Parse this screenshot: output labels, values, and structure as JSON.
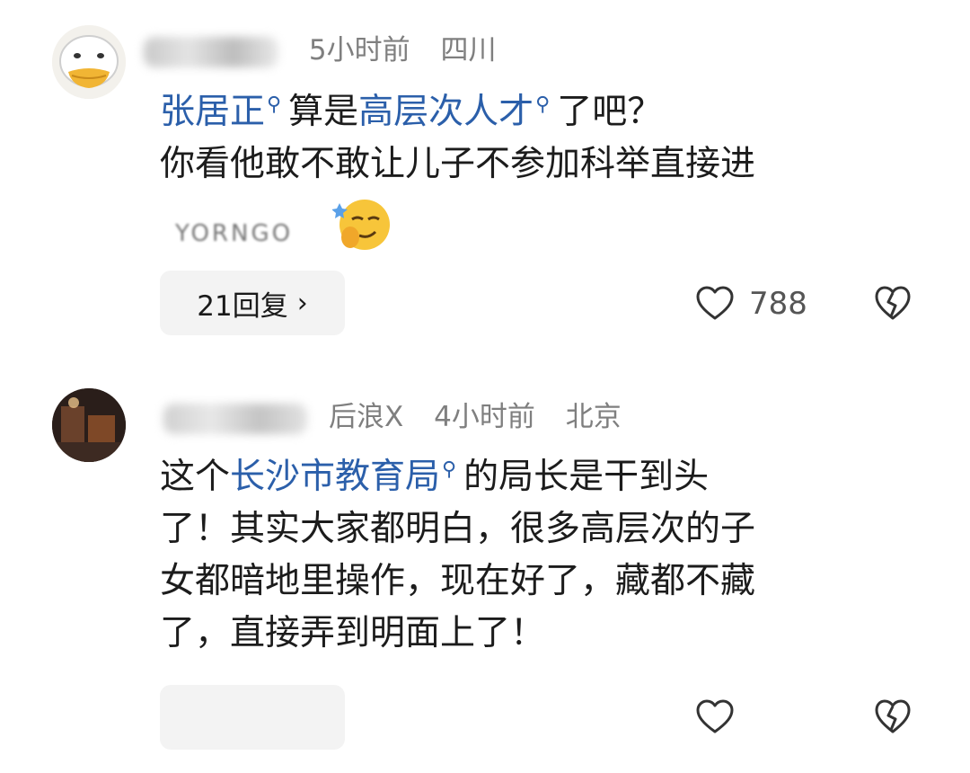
{
  "comments": [
    {
      "time": "5小时前",
      "location": "四川",
      "body": [
        [
          {
            "t": "张居正",
            "link": true
          },
          {
            "t": "算是"
          },
          {
            "t": "高层次人才",
            "link": true
          },
          {
            "t": "了吧？"
          }
        ],
        [
          {
            "t": "你看他敢不敢让儿子不参加科举直接进"
          }
        ]
      ],
      "sticker_text": "YORNGO",
      "reply_label": "21回复",
      "likes": "788"
    },
    {
      "name_suffix": "后浪X",
      "time": "4小时前",
      "location": "北京",
      "body": [
        [
          {
            "t": "这个"
          },
          {
            "t": "长沙市教育局",
            "link": true
          },
          {
            "t": "的局长是干到头"
          }
        ],
        [
          {
            "t": "了！其实大家都明白，很多高层次的子"
          }
        ],
        [
          {
            "t": "女都暗地里操作，现在好了，藏都不藏"
          }
        ],
        [
          {
            "t": "了，直接弄到明面上了！"
          }
        ]
      ],
      "reply_label": "",
      "likes": ""
    }
  ],
  "icons": {
    "search_hint": "magnifier-icon",
    "like": "heart-outline-icon",
    "dislike": "broken-heart-icon",
    "reply_chevron": "chevron-right-icon"
  },
  "colors": {
    "link": "#2b5faa",
    "meta": "#7f7f7f",
    "reply_bg": "#f3f3f3"
  }
}
